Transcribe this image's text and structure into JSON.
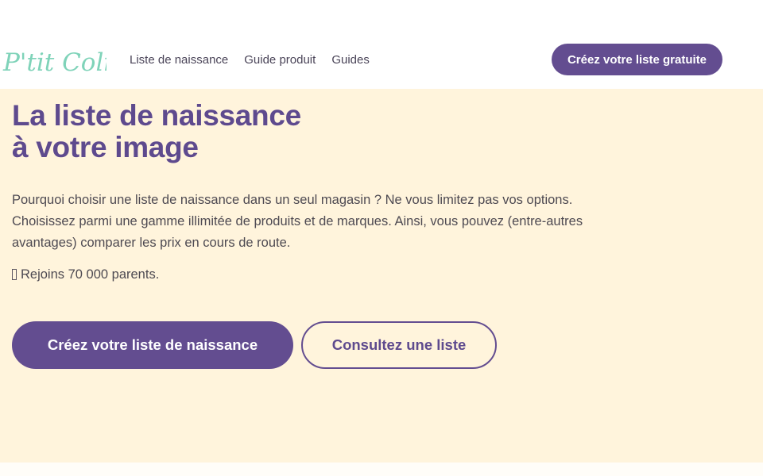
{
  "brand": {
    "logo_text": "P'tit Colis",
    "logo_color": "#7fd3b9"
  },
  "nav": {
    "items": [
      {
        "label": "Liste de naissance"
      },
      {
        "label": "Guide produit"
      },
      {
        "label": "Guides"
      }
    ],
    "cta_label": "Créez votre liste gratuite"
  },
  "hero": {
    "title_line1": "La liste de naissance",
    "title_line2": "à votre image",
    "description": "Pourquoi choisir une liste de naissance dans un seul magasin ? Ne vous limitez pas vos options. Choisissez parmi une gamme illimitée de produits et de marques. Ainsi, vous pouvez (entre-autres avantages) comparer les prix en cours de route.",
    "join_icon": "missing-glyph-icon",
    "join_text": "Rejoins 70 000 parents.",
    "primary_cta": "Créez votre liste de naissance",
    "secondary_cta": "Consultez une liste"
  },
  "colors": {
    "brand_purple": "#634d90",
    "hero_background": "#fff4dc",
    "logo_mint": "#7fd3b9"
  }
}
